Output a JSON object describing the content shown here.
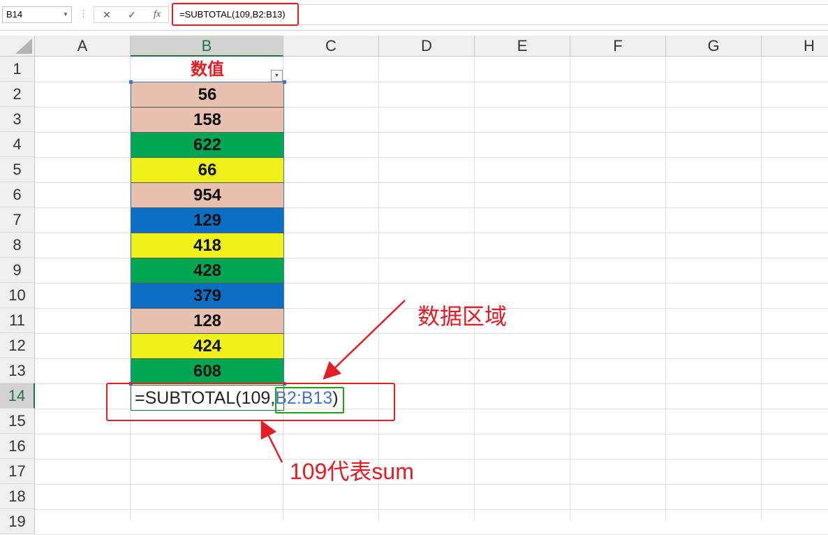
{
  "formula_bar": {
    "name_box": "B14",
    "cancel_icon": "✕",
    "enter_icon": "✓",
    "fx_icon": "fx",
    "formula": "=SUBTOTAL(109,B2:B13)"
  },
  "columns": [
    "A",
    "B",
    "C",
    "D",
    "E",
    "F",
    "G",
    "H"
  ],
  "rows": [
    "1",
    "2",
    "3",
    "4",
    "5",
    "6",
    "7",
    "8",
    "9",
    "10",
    "11",
    "12",
    "13",
    "14",
    "15",
    "16",
    "17",
    "18",
    "19"
  ],
  "sheet": {
    "header_label": "数值",
    "values": [
      {
        "value": "56",
        "color": "#e6c1af"
      },
      {
        "value": "158",
        "color": "#e6c1af"
      },
      {
        "value": "622",
        "color": "#00a651"
      },
      {
        "value": "66",
        "color": "#eef21a"
      },
      {
        "value": "954",
        "color": "#e6c1af"
      },
      {
        "value": "129",
        "color": "#0a6fc4"
      },
      {
        "value": "418",
        "color": "#eef21a"
      },
      {
        "value": "428",
        "color": "#00a651"
      },
      {
        "value": "379",
        "color": "#0a6fc4"
      },
      {
        "value": "128",
        "color": "#e6c1af"
      },
      {
        "value": "424",
        "color": "#eef21a"
      },
      {
        "value": "608",
        "color": "#00a651"
      }
    ],
    "edit_prefix": "=SUBTOTAL(109,",
    "edit_ref": "B2:B13",
    "edit_suffix": ")"
  },
  "annotations": {
    "data_area": "数据区域",
    "sum_note": "109代表sum"
  },
  "colors": {
    "accent_red": "#e51c23",
    "excel_green": "#217346",
    "ref_blue": "#4472c4",
    "ref_box_green": "#1aa41a"
  }
}
